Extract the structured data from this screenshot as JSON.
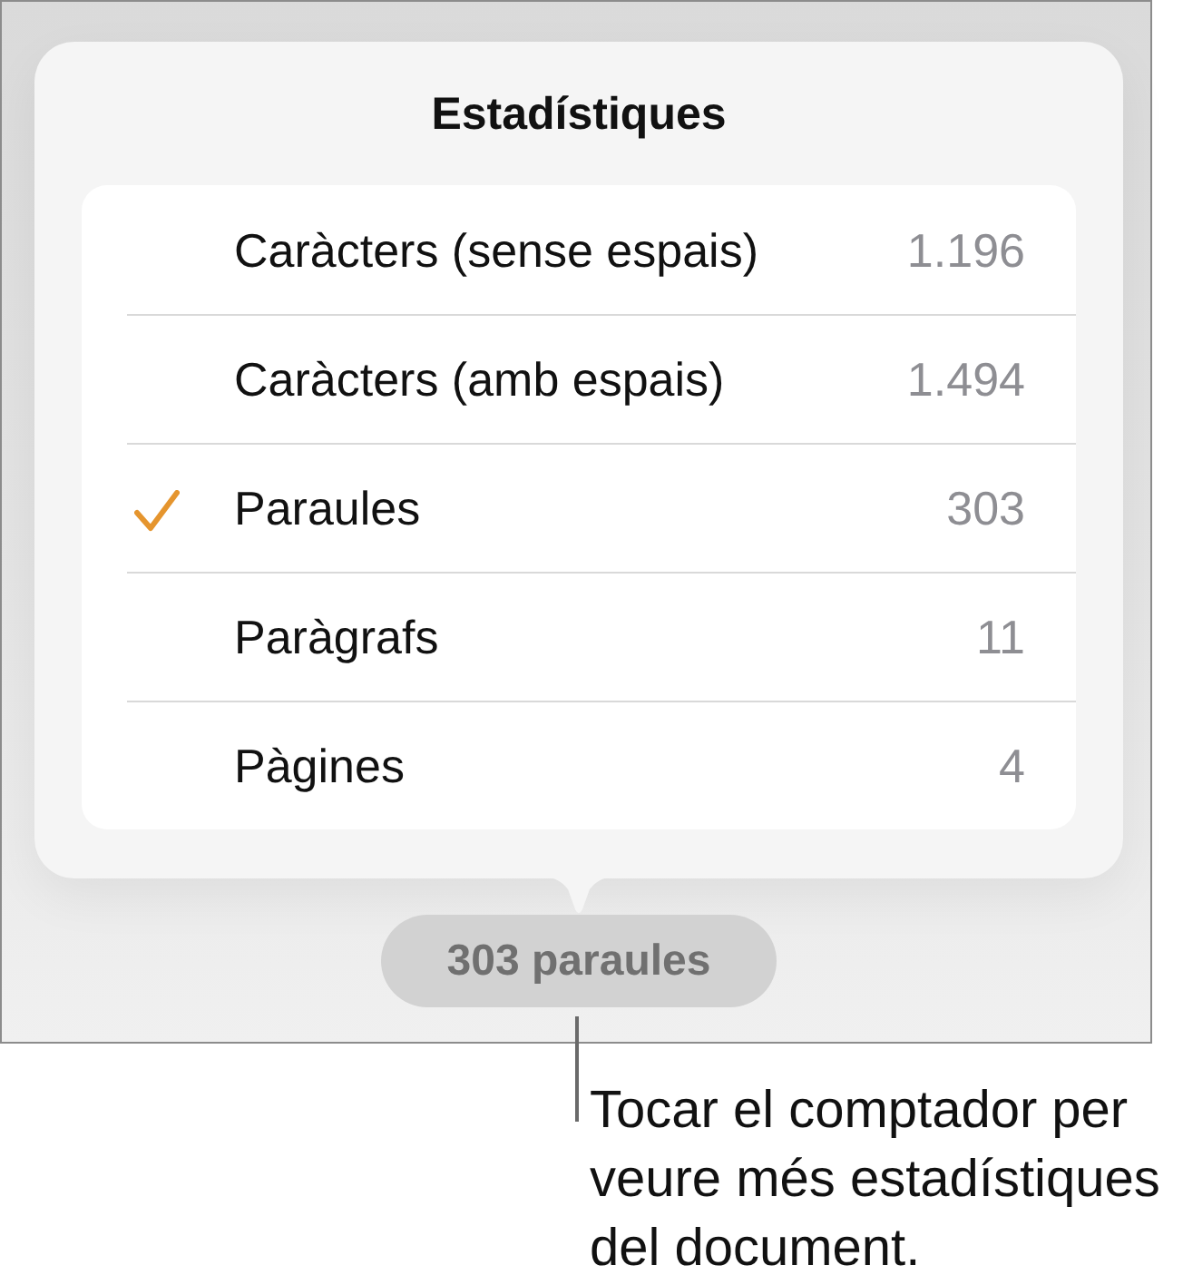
{
  "popover": {
    "title": "Estadístiques",
    "rows": [
      {
        "label": "Caràcters (sense espais)",
        "value": "1.196",
        "selected": false
      },
      {
        "label": "Caràcters (amb espais)",
        "value": "1.494",
        "selected": false
      },
      {
        "label": "Paraules",
        "value": "303",
        "selected": true
      },
      {
        "label": "Paràgrafs",
        "value": "11",
        "selected": false
      },
      {
        "label": "Pàgines",
        "value": "4",
        "selected": false
      }
    ]
  },
  "word_count_button": {
    "label": "303 paraules"
  },
  "callout": {
    "text": "Tocar el comptador per veure més estadístiques del document."
  }
}
